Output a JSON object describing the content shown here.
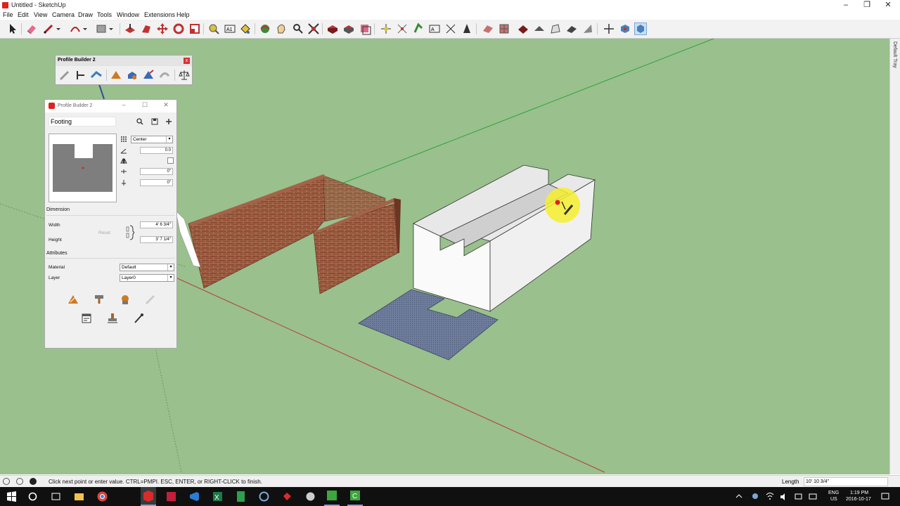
{
  "window": {
    "title": "Untitled - SketchUp",
    "controls": [
      "–",
      "❐",
      "✕"
    ]
  },
  "menu": [
    "File",
    "Edit",
    "View",
    "Camera",
    "Draw",
    "Tools",
    "Window",
    "Extensions",
    "Help"
  ],
  "toolbar_tools": [
    "select",
    "eraser",
    "pencil",
    "line-dropdown",
    "arc",
    "arc-dropdown",
    "rectangle",
    "rectangle-dropdown",
    "push-pull",
    "follow-me",
    "move",
    "rotate",
    "scale",
    "offset",
    "tape-measure",
    "dimension",
    "protractor",
    "orbit",
    "pan",
    "zoom",
    "zoom-extents",
    "paint-bucket",
    "component",
    "group",
    "section-plane",
    "text",
    "axes",
    "3d-text",
    "walk",
    "look-around",
    "position-camera",
    "sandbox-1",
    "sandbox-2",
    "sandbox-3",
    "sandbox-4",
    "sandbox-5",
    "sandbox-6",
    "sandbox-7",
    "navigation-1",
    "navigation-2",
    "navigation-3"
  ],
  "profile_toolbar": {
    "title": "Profile Builder 2",
    "close": "x",
    "tools": [
      "profile-pencil",
      "profile-eyedropper",
      "build-along-path",
      "build-with-faces",
      "build-assembly",
      "explode",
      "reverse",
      "balance"
    ]
  },
  "profile_window": {
    "title": "Profile Builder 2",
    "profile_name": "Footing",
    "alignment": "Center",
    "rotation": "0.0",
    "offset_x": "0\"",
    "offset_y": "0\"",
    "dimension_header": "Dimension",
    "width_label": "Width",
    "width_value": "4' 6 3/4\"",
    "height_label": "Height",
    "height_value": "3' 7 1/4\"",
    "reset_label": "Reset",
    "attributes_header": "Attributes",
    "material_label": "Material",
    "material_value": "Default",
    "layer_label": "Layer",
    "layer_value": "Layer0"
  },
  "tray": {
    "label": "Default Tray"
  },
  "status": {
    "hint": "Click next point or enter value. CTRL=PMPI. ESC, ENTER, or RIGHT-CLICK to finish.",
    "length_label": "Length",
    "length_value": "10' 10 3/4\""
  },
  "taskbar": {
    "apps": [
      "start",
      "cortana",
      "task-view",
      "file-explorer",
      "chrome",
      "sketchup",
      "app-red",
      "visual-studio",
      "excel",
      "sheets",
      "network",
      "app-red-2",
      "app-gray",
      "camtasia",
      "camtasia-recorder"
    ],
    "lang": "ENG",
    "region": "US",
    "time": "1:19 PM",
    "date": "2016-10-17"
  },
  "colors": {
    "viewport": "#99c08d",
    "brick": "#8e4b33",
    "footing_fill": "#6f7d9c",
    "highlight": "#f6ee2f"
  }
}
